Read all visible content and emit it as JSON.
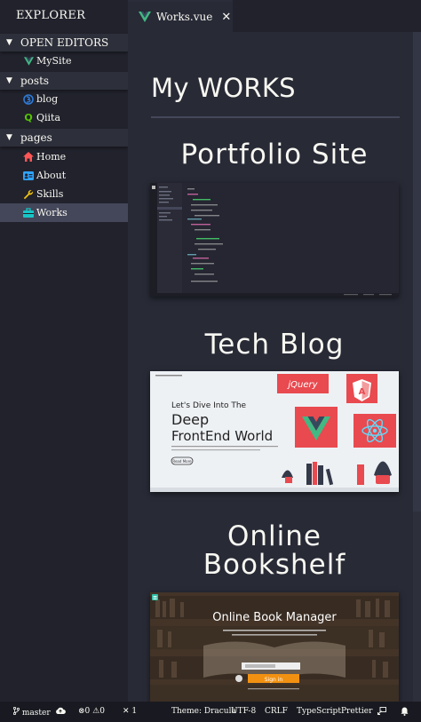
{
  "sidebar": {
    "title": "EXPLORER",
    "sections": {
      "open_editors": {
        "label": "OPEN EDITORS",
        "items": [
          "MySite"
        ]
      },
      "posts": {
        "label": "posts",
        "items": [
          "blog",
          "Qiita"
        ]
      },
      "pages": {
        "label": "pages",
        "items": [
          "Home",
          "About",
          "Skills",
          "Works"
        ]
      }
    },
    "active_item": "Works"
  },
  "tab": {
    "label": "Works.vue",
    "close": "✕"
  },
  "content": {
    "title": "My WORKS",
    "works": [
      {
        "title": "Portfolio Site"
      },
      {
        "title_line1": "Tech Blog"
      },
      {
        "title_line1": "Online",
        "title_line2": "Bookshelf"
      }
    ],
    "blog_thumb": {
      "brand": "jQuery",
      "tagline": "Let's Dive Into The",
      "headline1": "Deep",
      "headline2": "FrontEnd World",
      "button": "Read More"
    },
    "shelf_thumb": {
      "heading": "Online Book Manager",
      "cta": "Sign in"
    }
  },
  "status_bar": {
    "branch": "master",
    "errors": "0",
    "warnings": "0",
    "tools": "1",
    "theme": "Theme: Dracula",
    "encoding": "UTF-8",
    "eol": "CRLF",
    "language": "TypeScript",
    "formatter": "Prettier"
  },
  "colors": {
    "sidebar_bg": "#21222c",
    "editor_bg": "#282a36",
    "active_item": "#44475a",
    "status_bg": "#191a21",
    "vue_green": "#42b883",
    "jquery_red": "#e84a4f"
  }
}
